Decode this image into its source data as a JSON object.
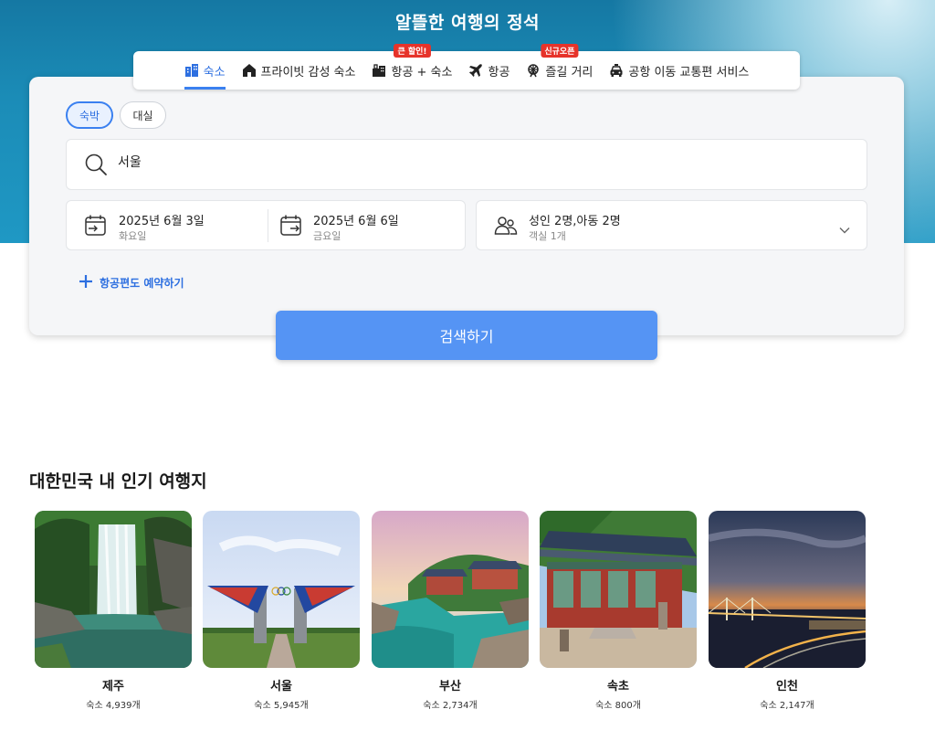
{
  "hero": {
    "title": "알뜰한 여행의 정석"
  },
  "tabs": [
    {
      "label": "숙소",
      "icon": "hotel-icon",
      "active": true
    },
    {
      "label": "프라이빗 감성 숙소",
      "icon": "house-icon"
    },
    {
      "label": "항공 + 숙소",
      "icon": "package-icon",
      "badge": "큰 할인!"
    },
    {
      "label": "항공",
      "icon": "plane-icon"
    },
    {
      "label": "즐길 거리",
      "icon": "ferris-wheel-icon",
      "badge": "신규오픈"
    },
    {
      "label": "공항 이동 교통편 서비스",
      "icon": "taxi-icon"
    }
  ],
  "search": {
    "chips": [
      {
        "label": "숙박",
        "active": true
      },
      {
        "label": "대실"
      }
    ],
    "destination": "서울",
    "checkin": {
      "date": "2025년 6월 3일",
      "weekday": "화요일"
    },
    "checkout": {
      "date": "2025년 6월 6일",
      "weekday": "금요일"
    },
    "guests": {
      "summary": "성인 2명,아동 2명",
      "rooms": "객실 1개"
    },
    "add_flight": "항공편도 예약하기",
    "button": "검색하기"
  },
  "popular": {
    "title": "대한민국 내 인기 여행지",
    "destinations": [
      {
        "name": "제주",
        "count": "숙소 4,939개"
      },
      {
        "name": "서울",
        "count": "숙소 5,945개"
      },
      {
        "name": "부산",
        "count": "숙소 2,734개"
      },
      {
        "name": "속초",
        "count": "숙소 800개"
      },
      {
        "name": "인천",
        "count": "숙소 2,147개"
      }
    ]
  },
  "colors": {
    "accent": "#3a80f0",
    "button": "#5594f4",
    "badge": "#e6332a",
    "hero": "#1b8cb7"
  }
}
